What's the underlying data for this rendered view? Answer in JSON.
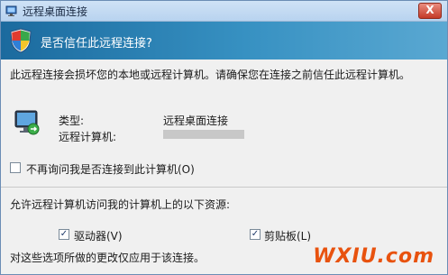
{
  "window": {
    "title": "远程桌面连接",
    "close_label": "X"
  },
  "banner": {
    "question": "是否信任此远程连接?"
  },
  "notice": "此远程连接会损坏您的本地或远程计算机。请确保您在连接之前信任此远程计算机。",
  "details": {
    "type_label": "类型:",
    "type_value": "远程桌面连接",
    "computer_label": "远程计算机:",
    "computer_value": ""
  },
  "dont_ask": {
    "label": "不再询问我是否连接到此计算机(O)",
    "checked": false
  },
  "resources": {
    "heading": "允许远程计算机访问我的计算机上的以下资源:",
    "items": [
      {
        "label": "驱动器(V)",
        "checked": true
      },
      {
        "label": "剪贴板(L)",
        "checked": true
      }
    ],
    "footer": "对这些选项所做的更改仅应用于该连接。"
  },
  "watermark": {
    "text": "WXIU.com",
    "subtext": ""
  },
  "colors": {
    "banner_start": "#1b6a9e",
    "banner_end": "#5aa8d2",
    "watermark": "#e8520e"
  }
}
